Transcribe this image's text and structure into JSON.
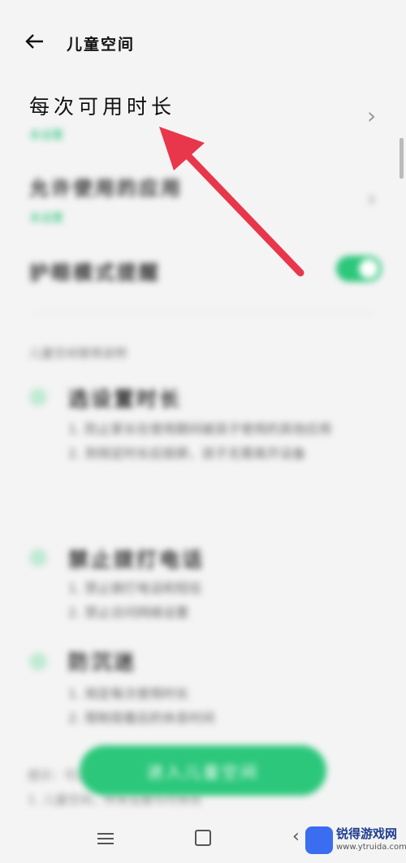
{
  "header": {
    "title": "儿童空间"
  },
  "highlight": {
    "label": "每次可用时长"
  },
  "blurred_rows": {
    "row1_sub": "未设置",
    "row2_title": "允许使用的应用",
    "row2_sub": "未设置",
    "row3_title": "护眼模式提醒"
  },
  "steps_section": {
    "label": "儿童空间使用说明",
    "steps": [
      {
        "title": "选设置时长",
        "desc": "1. 防止家长在使用期间被孩子使用的其他应用\n2. 到规定时长后锁屏，孩子无需离开设备"
      },
      {
        "title": "禁止拨打电话",
        "desc": "1. 禁止拨打电话和短信\n2. 禁止访问网络设置"
      },
      {
        "title": "防沉迷",
        "desc": "1. 规定每次使用时长\n2. 限制观看后的休息时间"
      }
    ]
  },
  "cta": {
    "label": "进入儿童空间"
  },
  "footer": {
    "text": "提示：可以通过设置儿童空间\n1. 儿童空间，所有设置均可修改"
  },
  "watermark": {
    "name": "锐得游戏网",
    "url": "www.ytruida.com"
  },
  "colors": {
    "accent": "#2cc77b",
    "arrow": "#e8374b"
  }
}
